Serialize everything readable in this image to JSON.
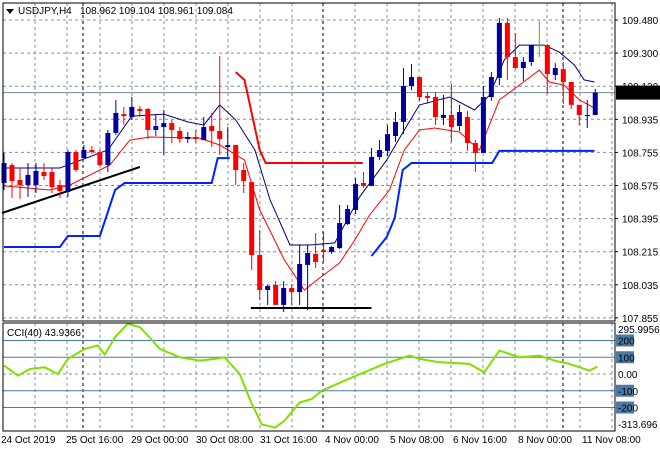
{
  "header": {
    "symbol": "USDJPY,H4",
    "ohlc": "108.962 109.104 108.961 109.084",
    "menu_icon": "triangle-down-icon"
  },
  "colors": {
    "bull": "#0000a0",
    "bear": "#ff0000",
    "doji": "#00dd00",
    "ma_fast": "#ff0000",
    "ma_slow": "#000080",
    "stop_red": "#ff0000",
    "stop_blue": "#0022ff",
    "cci": "#7fe000",
    "level": "#4a7aa5",
    "grid": "#8090a0"
  },
  "chart_data": [
    {
      "type": "candlestick",
      "title": "USDJPY,H4",
      "ylim": [
        107.855,
        109.55
      ],
      "price_ticks": [
        "109.480",
        "109.300",
        "109.120",
        "108.935",
        "108.755",
        "108.575",
        "108.395",
        "108.215",
        "108.035",
        "107.855"
      ],
      "current_price": "109.084",
      "time_labels": [
        "24 Oct 2019",
        "25 Oct 16:00",
        "29 Oct 00:00",
        "30 Oct 08:00",
        "31 Oct 16:00",
        "4 Nov 00:00",
        "5 Nov 08:00",
        "6 Nov 16:00",
        "8 Nov 00:00",
        "11 Nov 08:00"
      ],
      "candles_ohlc": [
        [
          108.591,
          108.755,
          108.553,
          108.7
        ],
        [
          108.689,
          108.7,
          108.509,
          108.602
        ],
        [
          108.607,
          108.673,
          108.504,
          108.58
        ],
        [
          108.58,
          108.7,
          108.515,
          108.635
        ],
        [
          108.58,
          108.7,
          108.536,
          108.657
        ],
        [
          108.651,
          108.7,
          108.607,
          108.629
        ],
        [
          108.651,
          108.673,
          108.536,
          108.569
        ],
        [
          108.58,
          108.607,
          108.509,
          108.547
        ],
        [
          108.542,
          108.771,
          108.515,
          108.76
        ],
        [
          108.76,
          108.771,
          108.651,
          108.662
        ],
        [
          108.727,
          108.798,
          108.727,
          108.771
        ],
        [
          108.771,
          108.793,
          108.749,
          108.76
        ],
        [
          108.76,
          108.771,
          108.684,
          108.689
        ],
        [
          108.689,
          108.88,
          108.651,
          108.864
        ],
        [
          108.864,
          109.044,
          108.853,
          108.973
        ],
        [
          108.967,
          109.006,
          108.907,
          108.956
        ],
        [
          108.951,
          109.06,
          108.935,
          109.006
        ],
        [
          108.995,
          109.011,
          108.951,
          108.984
        ],
        [
          108.995,
          109.0,
          108.831,
          108.88
        ],
        [
          108.88,
          108.962,
          108.847,
          108.902
        ],
        [
          108.896,
          108.989,
          108.744,
          108.918
        ],
        [
          108.918,
          108.935,
          108.809,
          108.88
        ],
        [
          108.875,
          108.896,
          108.809,
          108.831
        ],
        [
          108.831,
          108.869,
          108.809,
          108.842
        ],
        [
          108.842,
          108.88,
          108.809,
          108.831
        ],
        [
          108.825,
          108.951,
          108.825,
          108.896
        ],
        [
          108.902,
          108.973,
          108.787,
          108.875
        ],
        [
          108.875,
          109.284,
          108.744,
          108.831
        ],
        [
          108.787,
          108.896,
          108.733,
          108.798
        ],
        [
          108.798,
          108.798,
          108.58,
          108.662
        ],
        [
          108.662,
          108.7,
          108.536,
          108.602
        ],
        [
          108.596,
          108.596,
          108.116,
          108.198
        ],
        [
          108.198,
          108.335,
          107.953,
          108.007
        ],
        [
          108.007,
          108.035,
          107.926,
          108.029
        ],
        [
          108.035,
          108.056,
          107.926,
          107.926
        ],
        [
          107.926,
          108.056,
          107.887,
          108.018
        ],
        [
          108.018,
          108.035,
          107.926,
          107.996
        ],
        [
          107.996,
          108.253,
          107.926,
          108.149
        ],
        [
          108.144,
          108.253,
          107.898,
          108.209
        ],
        [
          108.204,
          108.318,
          108.127,
          108.16
        ],
        [
          108.225,
          108.324,
          108.16,
          108.215
        ],
        [
          108.215,
          108.247,
          108.204,
          108.242
        ],
        [
          108.236,
          108.471,
          108.231,
          108.373
        ],
        [
          108.367,
          108.471,
          108.362,
          108.449
        ],
        [
          108.444,
          108.618,
          108.422,
          108.585
        ],
        [
          108.591,
          108.651,
          108.564,
          108.575
        ],
        [
          108.575,
          108.782,
          108.575,
          108.733
        ],
        [
          108.733,
          108.825,
          108.716,
          108.771
        ],
        [
          108.766,
          108.907,
          108.738,
          108.858
        ],
        [
          108.847,
          108.978,
          108.815,
          108.924
        ],
        [
          108.924,
          109.218,
          108.858,
          109.12
        ],
        [
          109.12,
          109.24,
          109.098,
          109.169
        ],
        [
          109.169,
          109.169,
          109.039,
          109.06
        ],
        [
          109.066,
          109.087,
          109.022,
          109.055
        ],
        [
          109.06,
          109.087,
          108.907,
          108.951
        ],
        [
          108.946,
          109.071,
          108.907,
          108.962
        ],
        [
          108.962,
          109.131,
          108.815,
          108.896
        ],
        [
          108.902,
          109.017,
          108.875,
          108.978
        ],
        [
          108.951,
          108.984,
          108.766,
          108.809
        ],
        [
          108.809,
          108.825,
          108.651,
          108.755
        ],
        [
          108.755,
          109.12,
          108.755,
          109.06
        ],
        [
          109.06,
          109.196,
          109.039,
          109.169
        ],
        [
          109.164,
          109.491,
          109.125,
          109.464
        ],
        [
          109.464,
          109.491,
          109.153,
          109.278
        ],
        [
          109.278,
          109.409,
          109.212,
          109.218
        ],
        [
          109.218,
          109.278,
          109.147,
          109.251
        ],
        [
          109.251,
          109.343,
          109.229,
          109.343
        ],
        [
          109.343,
          109.475,
          109.278,
          109.343
        ],
        [
          109.343,
          109.349,
          109.077,
          109.185
        ],
        [
          109.18,
          109.245,
          109.153,
          109.218
        ],
        [
          109.212,
          109.251,
          109.022,
          109.142
        ],
        [
          109.142,
          109.142,
          108.995,
          109.017
        ],
        [
          109.017,
          109.017,
          108.907,
          108.962
        ],
        [
          108.956,
          109.044,
          108.891,
          108.962
        ],
        [
          108.962,
          109.104,
          108.961,
          109.084
        ]
      ],
      "overlays": [
        {
          "name": "ma-slow",
          "color_key": "ma_slow",
          "width": 1,
          "points": [
            [
              0,
              108.673
            ],
            [
              7,
              108.673
            ],
            [
              13,
              108.771
            ],
            [
              16,
              108.956
            ],
            [
              20,
              108.967
            ],
            [
              23,
              108.924
            ],
            [
              25,
              108.907
            ],
            [
              27,
              109.017
            ],
            [
              29,
              108.935
            ],
            [
              31.4,
              108.771
            ],
            [
              33.3,
              108.498
            ],
            [
              35.8,
              108.253
            ],
            [
              38.3,
              108.253
            ],
            [
              41.4,
              108.264
            ],
            [
              44.5,
              108.515
            ],
            [
              47.9,
              108.716
            ],
            [
              50.1,
              108.88
            ],
            [
              52,
              109.017
            ],
            [
              55.8,
              109.06
            ],
            [
              58.9,
              108.989
            ],
            [
              60.8,
              109.071
            ],
            [
              62.6,
              109.262
            ],
            [
              64.5,
              109.343
            ],
            [
              67.6,
              109.343
            ],
            [
              69.5,
              109.305
            ],
            [
              71.4,
              109.234
            ],
            [
              72.6,
              109.153
            ],
            [
              73.9,
              109.142
            ]
          ]
        },
        {
          "name": "ma-fast",
          "color_key": "ma_fast",
          "width": 1,
          "points": [
            [
              0,
              108.575
            ],
            [
              5.75,
              108.553
            ],
            [
              8.25,
              108.58
            ],
            [
              13.25,
              108.689
            ],
            [
              15.75,
              108.825
            ],
            [
              18.25,
              108.842
            ],
            [
              24.5,
              108.836
            ],
            [
              27,
              108.798
            ],
            [
              30.1,
              108.716
            ],
            [
              32,
              108.444
            ],
            [
              35.1,
              108.171
            ],
            [
              37.6,
              108.007
            ],
            [
              39.5,
              108.073
            ],
            [
              42,
              108.155
            ],
            [
              43.9,
              108.28
            ],
            [
              45.75,
              108.416
            ],
            [
              48.25,
              108.553
            ],
            [
              50.1,
              108.771
            ],
            [
              52,
              108.88
            ],
            [
              53.9,
              108.891
            ],
            [
              57,
              108.869
            ],
            [
              59.5,
              108.771
            ],
            [
              62,
              109.044
            ],
            [
              64.5,
              109.125
            ],
            [
              67,
              109.207
            ],
            [
              68.25,
              109.142
            ],
            [
              70.1,
              109.125
            ],
            [
              72,
              109.044
            ],
            [
              73.9,
              109.0
            ]
          ]
        },
        {
          "name": "stop-red",
          "color_key": "stop_red",
          "width": 2,
          "points": [
            [
              29,
              109.196
            ],
            [
              30.1,
              109.153
            ],
            [
              32,
              108.771
            ],
            [
              32.75,
              108.7
            ],
            [
              44.9,
              108.7
            ]
          ]
        },
        {
          "name": "stop-blue-1",
          "color_key": "stop_blue",
          "width": 2,
          "points": [
            [
              0,
              108.242
            ],
            [
              7,
              108.242
            ],
            [
              8,
              108.302
            ],
            [
              12,
              108.302
            ],
            [
              13.9,
              108.553
            ],
            [
              15.1,
              108.591
            ],
            [
              26,
              108.591
            ],
            [
              26.75,
              108.727
            ],
            [
              28.25,
              108.727
            ]
          ]
        },
        {
          "name": "stop-blue-2",
          "color_key": "stop_blue",
          "width": 2,
          "points": [
            [
              46,
              108.193
            ],
            [
              47.9,
              108.296
            ],
            [
              48.9,
              108.4
            ],
            [
              49.9,
              108.662
            ],
            [
              51,
              108.7
            ],
            [
              61.1,
              108.7
            ],
            [
              62,
              108.766
            ],
            [
              73.9,
              108.766
            ]
          ]
        },
        {
          "name": "trendline-support",
          "color_key": "black",
          "width": 2,
          "points": [
            [
              -0.25,
              108.427
            ],
            [
              17,
              108.678
            ]
          ]
        },
        {
          "name": "trendline-bottom",
          "color_key": "black",
          "width": 2,
          "points": [
            [
              30.9,
              107.909
            ],
            [
              46,
              107.909
            ]
          ]
        }
      ]
    },
    {
      "type": "line",
      "title": "CCI(40) 43.9366",
      "ylim": [
        -313.696,
        295.9956
      ],
      "range_labels": [
        "295.9956",
        "-313.696"
      ],
      "levels": [
        200,
        100,
        0,
        -100,
        -200
      ],
      "level_labels": [
        "200",
        "100",
        "0.00",
        "-100",
        "-200"
      ],
      "points": [
        [
          0,
          50
        ],
        [
          1.75,
          -10
        ],
        [
          3.25,
          30
        ],
        [
          5.1,
          40
        ],
        [
          6.75,
          0
        ],
        [
          8,
          90
        ],
        [
          10.1,
          150
        ],
        [
          11.75,
          170
        ],
        [
          12.6,
          115
        ],
        [
          13.9,
          220
        ],
        [
          15.5,
          300
        ],
        [
          17,
          280
        ],
        [
          18,
          230
        ],
        [
          19.5,
          150
        ],
        [
          22,
          100
        ],
        [
          24.5,
          80
        ],
        [
          26.4,
          90
        ],
        [
          27.6,
          100
        ],
        [
          29.5,
          0
        ],
        [
          30.75,
          -150
        ],
        [
          32.25,
          -300
        ],
        [
          33.9,
          -320
        ],
        [
          35.1,
          -280
        ],
        [
          37,
          -170
        ],
        [
          38.5,
          -150
        ],
        [
          39.75,
          -100
        ],
        [
          42.6,
          -40
        ],
        [
          45.1,
          10
        ],
        [
          47.6,
          60
        ],
        [
          50.75,
          110
        ],
        [
          52,
          90
        ],
        [
          54.5,
          70
        ],
        [
          58.25,
          60
        ],
        [
          60.1,
          10
        ],
        [
          62,
          140
        ],
        [
          64.5,
          100
        ],
        [
          67,
          110
        ],
        [
          68.9,
          80
        ],
        [
          70.75,
          60
        ],
        [
          73.25,
          20
        ],
        [
          74.25,
          44
        ]
      ]
    }
  ]
}
